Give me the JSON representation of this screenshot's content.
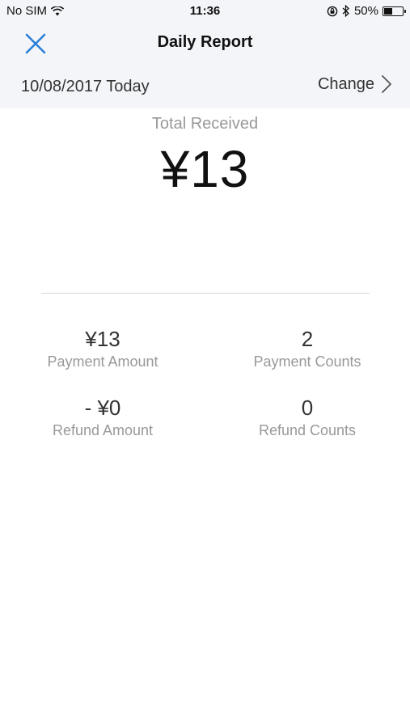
{
  "status_bar": {
    "carrier": "No SIM",
    "time": "11:36",
    "battery_percent": "50%",
    "battery_level": 0.5,
    "icons": [
      "wifi-icon",
      "rotation-lock-icon",
      "bluetooth-icon",
      "battery-icon"
    ]
  },
  "nav": {
    "title": "Daily Report",
    "close_icon": "close-icon"
  },
  "date_bar": {
    "date": "10/08/2017 Today",
    "change_label": "Change",
    "chevron_icon": "chevron-right-icon"
  },
  "summary": {
    "total_label": "Total Received",
    "total_amount": "¥13"
  },
  "stats": [
    {
      "value": "¥13",
      "label": "Payment Amount"
    },
    {
      "value": "2",
      "label": "Payment Counts"
    },
    {
      "value": "- ¥0",
      "label": "Refund Amount"
    },
    {
      "value": "0",
      "label": "Refund Counts"
    }
  ],
  "colors": {
    "accent": "#2a7fd8",
    "header_bg": "#f4f5f9",
    "muted_text": "#999999"
  }
}
